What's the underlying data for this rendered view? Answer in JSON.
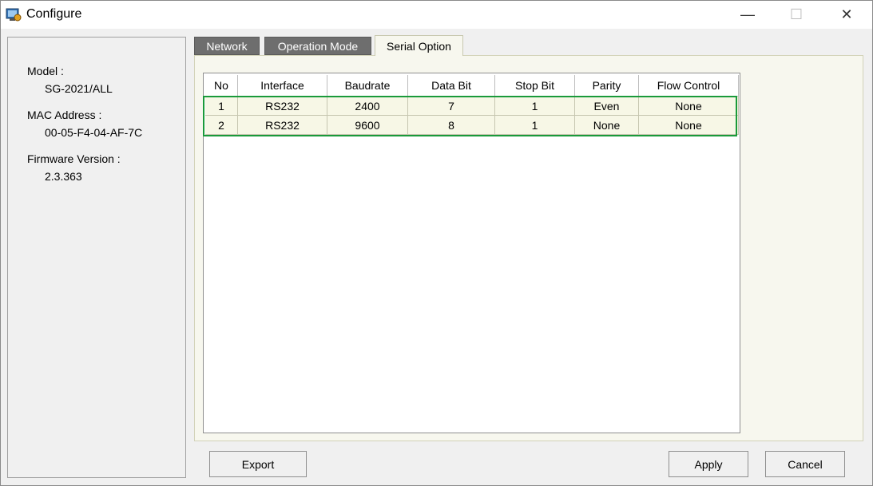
{
  "window": {
    "title": "Configure",
    "controls": {
      "minimize": "—",
      "maximize": "☐",
      "close": "✕"
    }
  },
  "device_info": {
    "model_label": "Model :",
    "model_value": "SG-2021/ALL",
    "mac_label": "MAC Address :",
    "mac_value": "00-05-F4-04-AF-7C",
    "firmware_label": "Firmware Version :",
    "firmware_value": "2.3.363"
  },
  "tabs": [
    {
      "label": "Network",
      "active": false
    },
    {
      "label": "Operation Mode",
      "active": false
    },
    {
      "label": "Serial Option",
      "active": true
    }
  ],
  "table": {
    "columns": [
      "No",
      "Interface",
      "Baudrate",
      "Data Bit",
      "Stop Bit",
      "Parity",
      "Flow Control"
    ],
    "rows": [
      [
        "1",
        "RS232",
        "2400",
        "7",
        "1",
        "Even",
        "None"
      ],
      [
        "2",
        "RS232",
        "9600",
        "8",
        "1",
        "None",
        "None"
      ]
    ]
  },
  "buttons": {
    "export": "Export",
    "apply": "Apply",
    "cancel": "Cancel"
  },
  "colors": {
    "highlight": "#1a9a3a",
    "row_background": "#f7f7e6",
    "inactive_tab": "#6e6e6e"
  }
}
